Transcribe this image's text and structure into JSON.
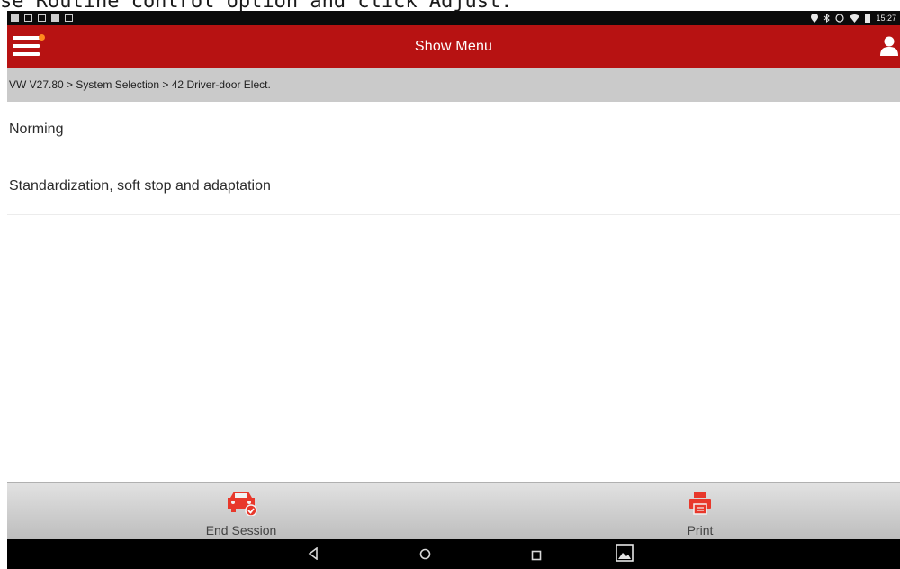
{
  "caption": {
    "text": "se Routine control option and click Adjust."
  },
  "status_bar": {
    "time": "15:27"
  },
  "app_bar": {
    "title": "Show Menu",
    "accent_color": "#b71212",
    "notification_dot_color": "#ff8a1e"
  },
  "breadcrumb": {
    "path": "VW V27.80 > System Selection > 42 Driver-door Elect."
  },
  "menu": {
    "items": [
      {
        "label": "Norming"
      },
      {
        "label": "Standardization, soft stop and adaptation"
      }
    ]
  },
  "toolbar": {
    "end_session_label": "End Session",
    "end_session_icon": "car-check-icon",
    "print_label": "Print",
    "print_icon": "printer-icon",
    "icon_color": "#e8382b"
  },
  "nav": {
    "back_icon": "back-icon",
    "home_icon": "home-icon",
    "recents_icon": "recents-icon",
    "screenshot_icon": "gallery-icon"
  }
}
